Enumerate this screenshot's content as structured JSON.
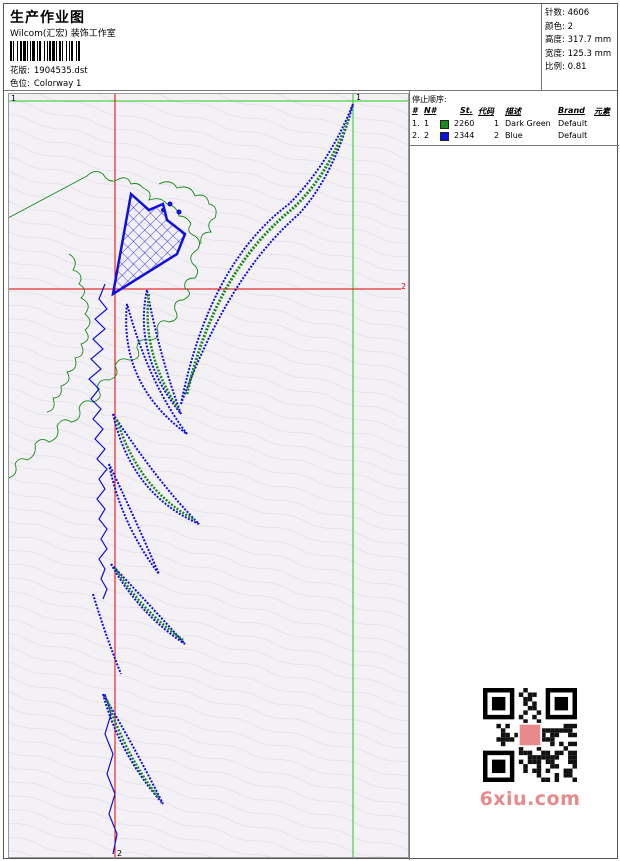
{
  "header": {
    "title": "生产作业图",
    "studio": "Wilcom(汇宏) 装饰工作室",
    "design_label": "花版:",
    "design_value": "1904535.dst",
    "colorway_label": "色位:",
    "colorway_value": "Colorway 1"
  },
  "stats": [
    {
      "label": "针数:",
      "value": "4606"
    },
    {
      "label": "颜色:",
      "value": "2"
    },
    {
      "label": "高度:",
      "value": "317.7 mm"
    },
    {
      "label": "宽度:",
      "value": "125.3 mm"
    },
    {
      "label": "比例:",
      "value": "0.81"
    }
  ],
  "guides": {
    "vertical_1_label": "1",
    "vertical_2_label": "2",
    "horizontal_2_label": "2",
    "corner_label": "1"
  },
  "color_table": {
    "title": "停止顺序:",
    "headers": {
      "index": "#",
      "needle": "N#",
      "stitches": "St.",
      "code": "代码",
      "description": "描述",
      "brand": "Brand",
      "element": "元素"
    },
    "rows": [
      {
        "index": "1.",
        "needle": "1",
        "color": "#1a8a1a",
        "stitches": "2260",
        "code": "1",
        "description": "Dark Green",
        "brand": "Default"
      },
      {
        "index": "2.",
        "needle": "2",
        "color": "#1010e0",
        "stitches": "2344",
        "code": "2",
        "description": "Blue",
        "brand": "Default"
      }
    ]
  },
  "watermark": {
    "text": "6xiu.com"
  },
  "colors": {
    "green_thread": "#1a8a1a",
    "blue_thread": "#1010e0",
    "guide_red": "#e00000",
    "guide_green": "#22cc22"
  }
}
